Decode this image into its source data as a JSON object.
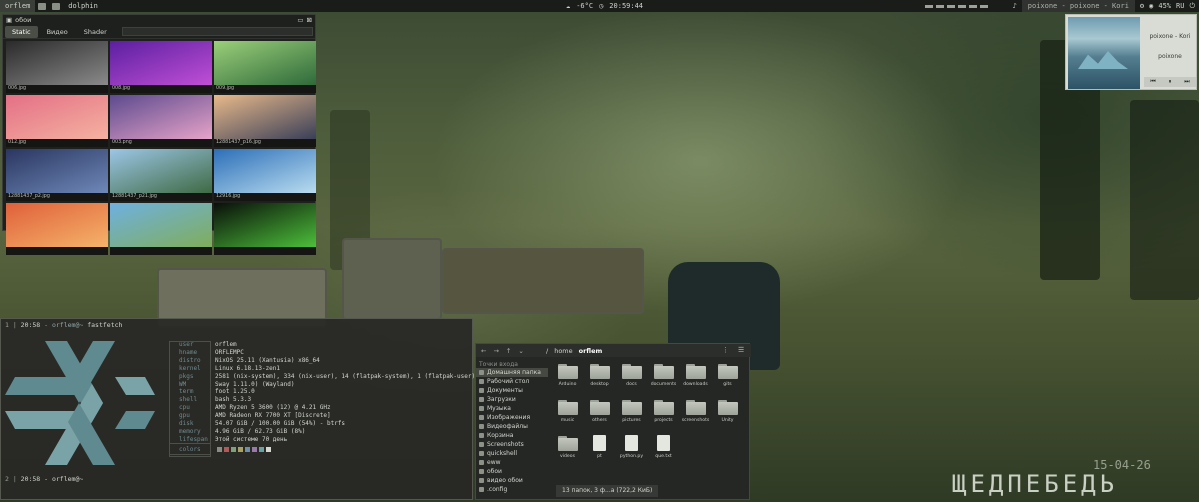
{
  "topbar": {
    "workspace": "orflem",
    "app": "dolphin",
    "weather": "-6°C",
    "clock": "20:59:44",
    "media": "poixone - poixone - Kori",
    "volume": "45%",
    "layout": "RU"
  },
  "wallpaper_picker": {
    "title": "обои",
    "tabs": [
      "Static",
      "Видео",
      "Shader"
    ],
    "items": [
      {
        "name": "006.jpg",
        "colors": [
          "#2a2a2a",
          "#8a8a8a"
        ]
      },
      {
        "name": "008.jpg",
        "colors": [
          "#5b1fa0",
          "#c04fd6"
        ]
      },
      {
        "name": "009.jpg",
        "colors": [
          "#9bcf7a",
          "#2f6a3a"
        ]
      },
      {
        "name": "012.jpg",
        "colors": [
          "#e46f86",
          "#f5b2a0"
        ]
      },
      {
        "name": "003.png",
        "colors": [
          "#5c4a8e",
          "#e6a3c8"
        ]
      },
      {
        "name": "12881437_p16.jpg",
        "colors": [
          "#e8b98a",
          "#3a3f58"
        ]
      },
      {
        "name": "12881437_p2.jpg",
        "colors": [
          "#2a3660",
          "#6e88b8"
        ]
      },
      {
        "name": "12881437_p21.jpg",
        "colors": [
          "#9cc6e6",
          "#3f6a44"
        ]
      },
      {
        "name": "12916.jpg",
        "colors": [
          "#2c6fb8",
          "#b9dcf0"
        ]
      },
      {
        "name": "",
        "colors": [
          "#e0603a",
          "#f5b36a"
        ]
      },
      {
        "name": "",
        "colors": [
          "#6fb0e0",
          "#7fae5a"
        ]
      },
      {
        "name": "",
        "colors": [
          "#0a0f0a",
          "#4cbf3a"
        ]
      }
    ]
  },
  "media_widget": {
    "title": "poixone - Kori",
    "artist": "poixone",
    "controls": [
      "prev",
      "play",
      "next"
    ]
  },
  "terminal": {
    "prompt_time": "20:58",
    "prompt_user": "orflem@~",
    "command": "fastfetch",
    "info_keys": [
      "user",
      "hname",
      "distro",
      "kernel",
      "pkgs",
      "WM",
      "term",
      "shell",
      "cpu",
      "gpu",
      "disk",
      "memory",
      "lifespan"
    ],
    "info_values": [
      "orflem",
      "ORFLEMPC",
      "NixOS 25.11 (Xantusia) x86_64",
      "Linux 6.18.13-zen1",
      "2581 (nix-system), 334 (nix-user), 14 (flatpak-system), 1 (flatpak-user)",
      "Sway 1.11.0) (Wayland)",
      "foot 1.25.0",
      "bash 5.3.3",
      "AMD Ryzen 5 3600 (12) @ 4.21 GHz",
      "AMD Radeon RX 7700 XT [Discrete]",
      "54.07 GiB / 100.00 GiB (54%) - btrfs",
      "4.96 GiB / 62.73 GiB (8%)",
      "Этой системе 70 день"
    ],
    "colors_label": "colors",
    "swatches": [
      "#8c8a85",
      "#b05a5a",
      "#7fa07a",
      "#a8a064",
      "#6f8fa8",
      "#9a7aa8",
      "#6aa0a0",
      "#d5d8d0"
    ],
    "last_prompt": "20:58 - orflem@~"
  },
  "file_manager": {
    "path": [
      "/",
      "home",
      "orflem"
    ],
    "sidebar_header": "Точки входа",
    "sidebar": [
      "Домашняя папка",
      "Рабочий стол",
      "Документы",
      "Загрузки",
      "Музыка",
      "Изображения",
      "Видеофайлы",
      "Корзина",
      "Screenshots",
      "quickshell",
      "eww",
      "обои",
      "видео обои",
      ".config"
    ],
    "items": [
      {
        "name": "Arduino",
        "kind": "folder"
      },
      {
        "name": "desktop",
        "kind": "folder"
      },
      {
        "name": "docs",
        "kind": "folder"
      },
      {
        "name": "documents",
        "kind": "folder"
      },
      {
        "name": "downloads",
        "kind": "folder"
      },
      {
        "name": "gits",
        "kind": "folder"
      },
      {
        "name": "music",
        "kind": "folder"
      },
      {
        "name": "others",
        "kind": "folder"
      },
      {
        "name": "pictures",
        "kind": "folder"
      },
      {
        "name": "projects",
        "kind": "folder"
      },
      {
        "name": "screenshots",
        "kind": "folder"
      },
      {
        "name": "Unity",
        "kind": "folder"
      },
      {
        "name": "videos",
        "kind": "folder"
      },
      {
        "name": "pt",
        "kind": "file"
      },
      {
        "name": "python.py",
        "kind": "file"
      },
      {
        "name": "que.txt",
        "kind": "file"
      }
    ],
    "status": "13 папок, 3 ф...а (722,2 КиБ)"
  },
  "desktop_clock": {
    "date": "15-04-26",
    "weekday": "ЩЕДПЕБЕДЬ"
  }
}
